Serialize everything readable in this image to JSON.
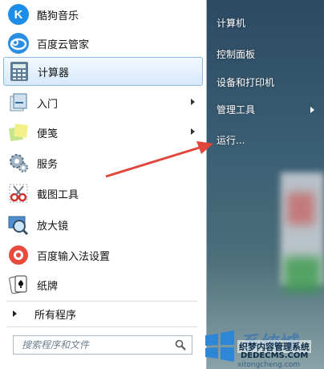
{
  "left_items": [
    {
      "label": "酷狗音乐",
      "icon": "kugou-music-icon"
    },
    {
      "label": "百度云管家",
      "icon": "baidu-cloud-icon"
    },
    {
      "label": "计算器",
      "icon": "calculator-icon"
    },
    {
      "label": "入门",
      "icon": "getting-started-icon"
    },
    {
      "label": "便笺",
      "icon": "sticky-notes-icon"
    },
    {
      "label": "服务",
      "icon": "services-gear-icon"
    },
    {
      "label": "截图工具",
      "icon": "snipping-tool-icon"
    },
    {
      "label": "放大镜",
      "icon": "magnifier-icon"
    },
    {
      "label": "百度输入法设置",
      "icon": "baidu-ime-settings-icon"
    },
    {
      "label": "纸牌",
      "icon": "solitaire-icon"
    }
  ],
  "all_programs": "所有程序",
  "search": {
    "placeholder": "搜索程序和文件"
  },
  "right_items": [
    {
      "label": "计算机"
    },
    {
      "label": "控制面板"
    },
    {
      "label": "设备和打印机"
    },
    {
      "label": "管理工具"
    },
    {
      "label": "运行..."
    }
  ],
  "watermark": {
    "brand": "系统城",
    "line1": "织梦内容管理系统",
    "line2": "DEDECMS.COM",
    "line3": "xitongcheng.com"
  },
  "colors": {
    "selection": "#d6e9fb",
    "arrow": "#e0463c"
  }
}
